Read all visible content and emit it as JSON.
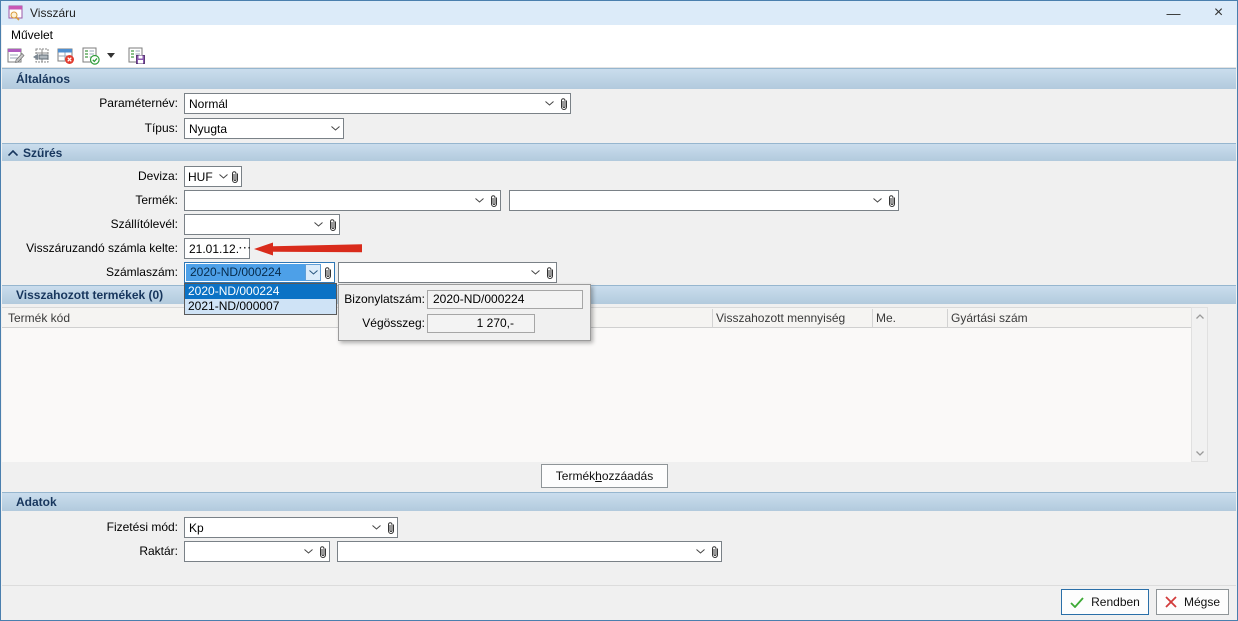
{
  "window": {
    "title": "Visszáru",
    "minimize_glyph": "—",
    "close_glyph": "×"
  },
  "menubar": {
    "items": [
      "Művelet"
    ]
  },
  "toolbar": {
    "icons": [
      "edit-parameters-icon",
      "insert-row-icon",
      "delete-row-icon",
      "confirm-list-icon",
      "toolbar-dropdown-icon",
      "save-list-icon"
    ]
  },
  "general": {
    "title": "Általános",
    "parameter_label": "Paraméternév:",
    "parameter_value": "Normál",
    "type_label": "Típus:",
    "type_value": "Nyugta"
  },
  "filter": {
    "title": "Szűrés",
    "deviza_label": "Deviza:",
    "deviza_value": "HUF",
    "termek_label": "Termék:",
    "szallitolevel_label": "Szállítólevél:",
    "szamla_kelte_label": "Visszáruzandó számla kelte:",
    "szamla_kelte_value": "21.01.12.",
    "szamla_kelte_button": "···",
    "szamlaszam_label": "Számlaszám:",
    "szamlaszam_value": "2020-ND/000224",
    "dropdown_options": [
      "2020-ND/000224",
      "2021-ND/000007"
    ],
    "tooltip": {
      "bizonylatszam_label": "Bizonylatszám:",
      "bizonylatszam_value": "2020-ND/000224",
      "vegosszeg_label": "Végösszeg:",
      "vegosszeg_value": "1 270,-"
    }
  },
  "products": {
    "title": "Visszahozott termékek (0)",
    "columns": [
      "Termék kód",
      "Visszahozott mennyiség",
      "Me.",
      "Gyártási szám"
    ],
    "add_button_prefix": "Termék ",
    "add_button_accel": "h",
    "add_button_suffix": "ozzáadás"
  },
  "adatok": {
    "title": "Adatok",
    "fizetesi_mod_label": "Fizetési mód:",
    "fizetesi_mod_value": "Kp",
    "raktar_label": "Raktár:"
  },
  "footer": {
    "ok_label": "Rendben",
    "cancel_label": "Mégse"
  },
  "colors": {
    "titlebar": "#dcebf9",
    "section_header": "#b8cfe0",
    "selection_blue": "#0b72c5",
    "combo_selection": "#4da0e8",
    "arrow_red": "#d92b1b",
    "ok_check_green": "#3daa35",
    "cancel_x_red": "#d23b3b"
  }
}
